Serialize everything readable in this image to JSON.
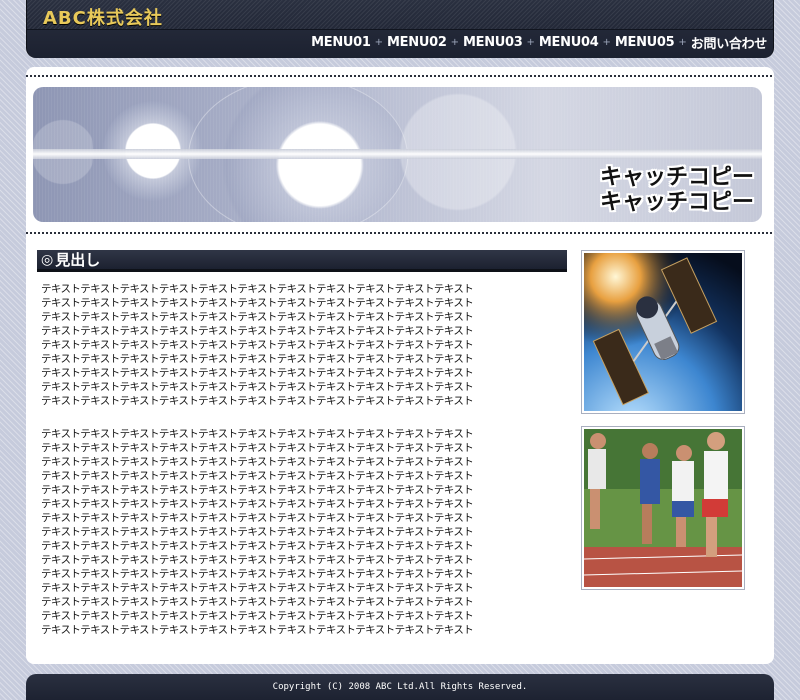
{
  "header": {
    "logo": "ABC株式会社",
    "menu": [
      {
        "label": "MENU01"
      },
      {
        "label": "MENU02"
      },
      {
        "label": "MENU03"
      },
      {
        "label": "MENU04"
      },
      {
        "label": "MENU05"
      },
      {
        "label": "お問い合わせ"
      }
    ],
    "menu_separator": "+"
  },
  "banner": {
    "catch_line1": "キャッチコピー",
    "catch_line2": "キャッチコピー"
  },
  "content": {
    "heading_icon": "◎",
    "heading": "見出し",
    "paragraph1": "テキストテキストテキストテキストテキストテキストテキストテキストテキストテキストテキスト\nテキストテキストテキストテキストテキストテキストテキストテキストテキストテキストテキスト\nテキストテキストテキストテキストテキストテキストテキストテキストテキストテキストテキスト\nテキストテキストテキストテキストテキストテキストテキストテキストテキストテキストテキスト\nテキストテキストテキストテキストテキストテキストテキストテキストテキストテキストテキスト\nテキストテキストテキストテキストテキストテキストテキストテキストテキストテキストテキスト\nテキストテキストテキストテキストテキストテキストテキストテキストテキストテキストテキスト\nテキストテキストテキストテキストテキストテキストテキストテキストテキストテキストテキスト\nテキストテキストテキストテキストテキストテキストテキストテキストテキストテキストテキスト",
    "paragraph2": "テキストテキストテキストテキストテキストテキストテキストテキストテキストテキストテキスト\nテキストテキストテキストテキストテキストテキストテキストテキストテキストテキストテキスト\nテキストテキストテキストテキストテキストテキストテキストテキストテキストテキストテキスト\nテキストテキストテキストテキストテキストテキストテキストテキストテキストテキストテキスト\nテキストテキストテキストテキストテキストテキストテキストテキストテキストテキストテキスト\nテキストテキストテキストテキストテキストテキストテキストテキストテキストテキストテキスト\nテキストテキストテキストテキストテキストテキストテキストテキストテキストテキストテキスト\nテキストテキストテキストテキストテキストテキストテキストテキストテキストテキストテキスト\nテキストテキストテキストテキストテキストテキストテキストテキストテキストテキストテキスト\nテキストテキストテキストテキストテキストテキストテキストテキストテキストテキストテキスト\nテキストテキストテキストテキストテキストテキストテキストテキストテキストテキストテキスト\nテキストテキストテキストテキストテキストテキストテキストテキストテキストテキストテキスト\nテキストテキストテキストテキストテキストテキストテキストテキストテキストテキストテキスト\nテキストテキストテキストテキストテキストテキストテキストテキストテキストテキストテキスト\nテキストテキストテキストテキストテキストテキストテキストテキストテキストテキストテキスト",
    "photos": [
      {
        "icon": "satellite-photo"
      },
      {
        "icon": "runners-photo"
      }
    ]
  },
  "footer": {
    "copyright": "Copyright (C) 2008 ABC Ltd.All Rights Reserved."
  },
  "colors": {
    "header_bg": "#1c2130",
    "logo": "#e8c95a",
    "page_bg": "#c6cbdc"
  }
}
